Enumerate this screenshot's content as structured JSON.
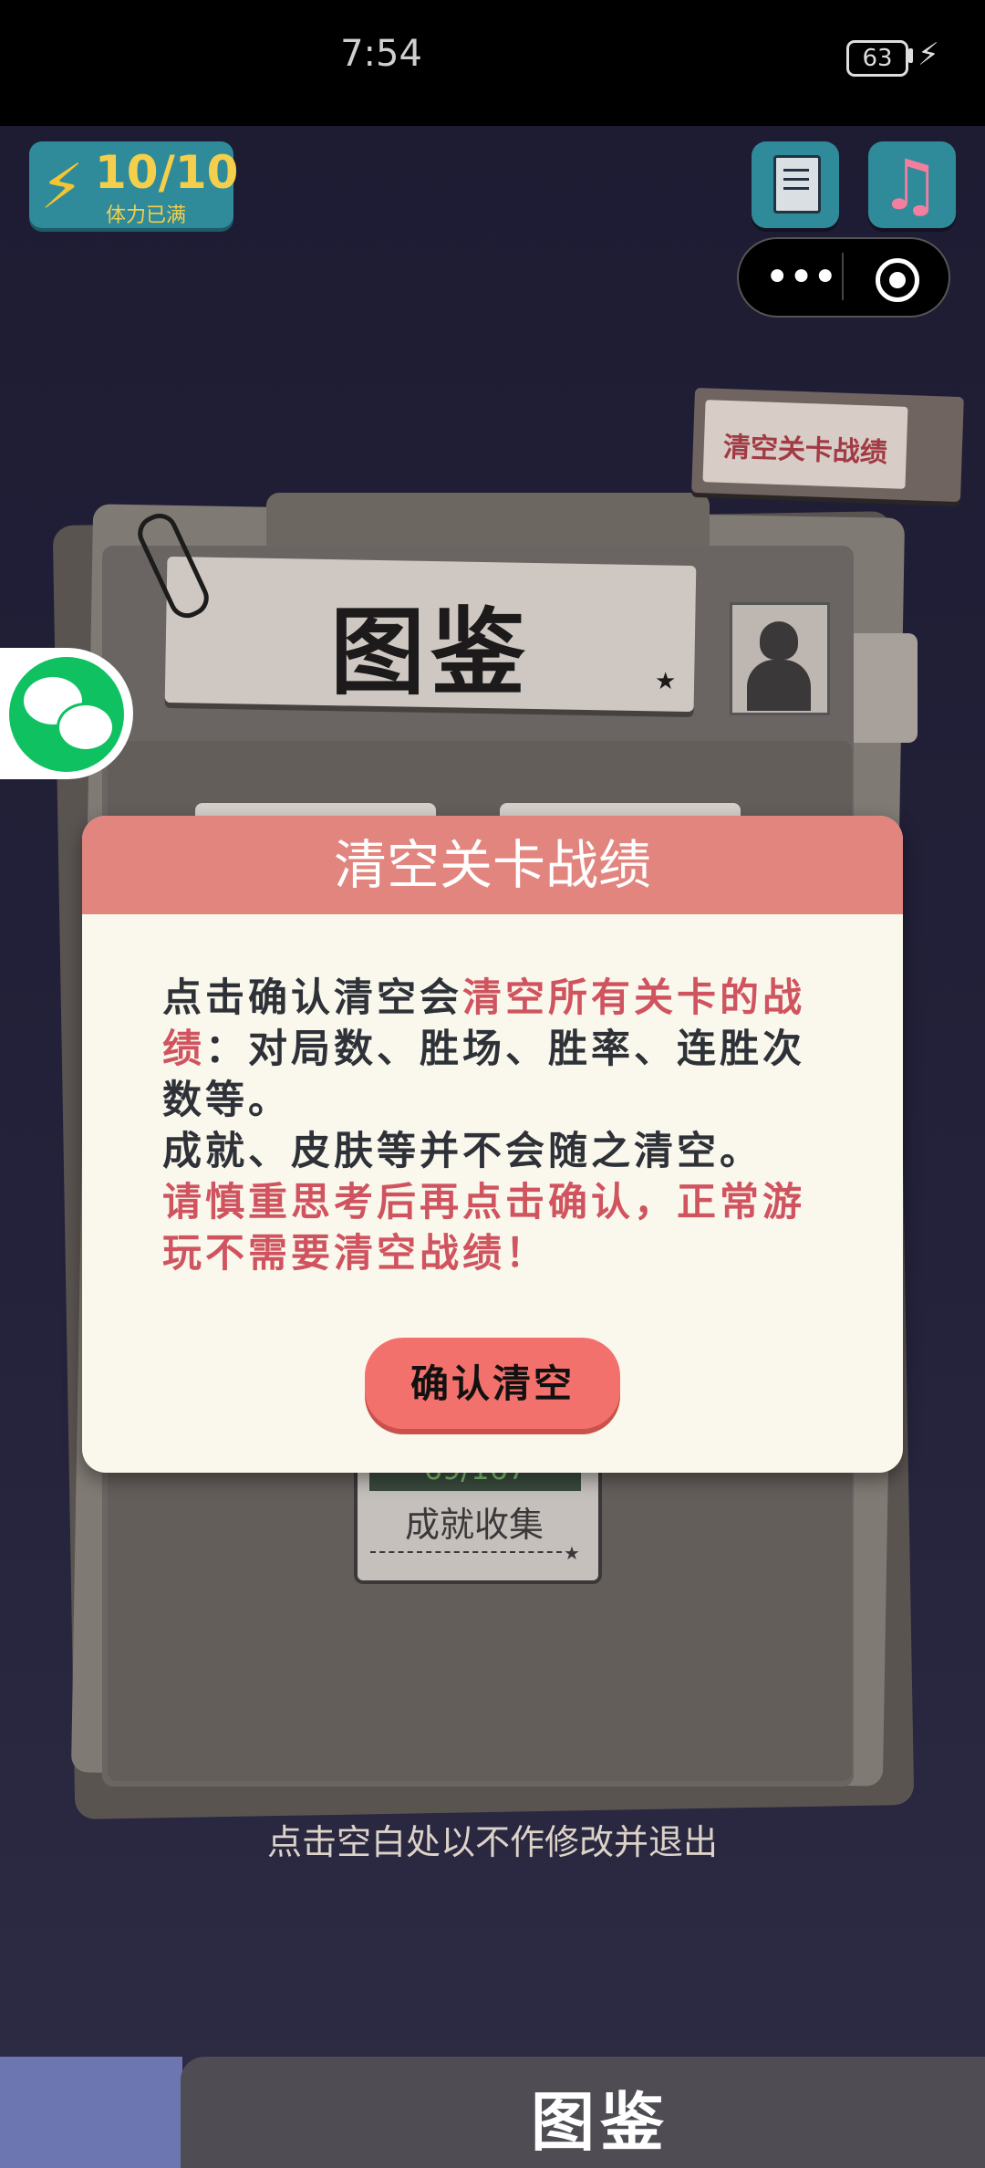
{
  "status_bar": {
    "time": "7:54",
    "battery": "63"
  },
  "energy": {
    "value": "10/10",
    "status": "体力已满"
  },
  "reset_tag": {
    "label": "清空关卡战绩"
  },
  "page": {
    "title": "图鉴"
  },
  "achievement": {
    "count": "69/167",
    "label": "成就收集"
  },
  "dialog": {
    "title": "清空关卡战绩",
    "body": [
      {
        "text": "点击确认清空会",
        "red": false
      },
      {
        "text": "清空所有关卡的战绩",
        "red": true
      },
      {
        "text": "：对局数、胜场、胜率、连胜次数等。",
        "red": false
      },
      {
        "text": "成就、皮肤等并不会随之清空。",
        "red": false
      },
      {
        "text": "请慎重思考后再点击确认，正常游玩不需要清空战绩！",
        "red": true
      }
    ],
    "confirm_label": "确认清空"
  },
  "exit_hint": "点击空白处以不作修改并退出",
  "bottom_tab": {
    "label": "图鉴"
  },
  "colors": {
    "modal_header": "#e1857e",
    "accent_red": "#d0545f",
    "button": "#f2716c",
    "teal": "#2f8a9a",
    "wechat": "#0fc160"
  },
  "icons": [
    "lightning-icon",
    "notes-icon",
    "music-note-icon",
    "more-icon",
    "close-circle-icon",
    "wechat-icon",
    "paperclip-icon",
    "detective-icon",
    "star-icon"
  ]
}
